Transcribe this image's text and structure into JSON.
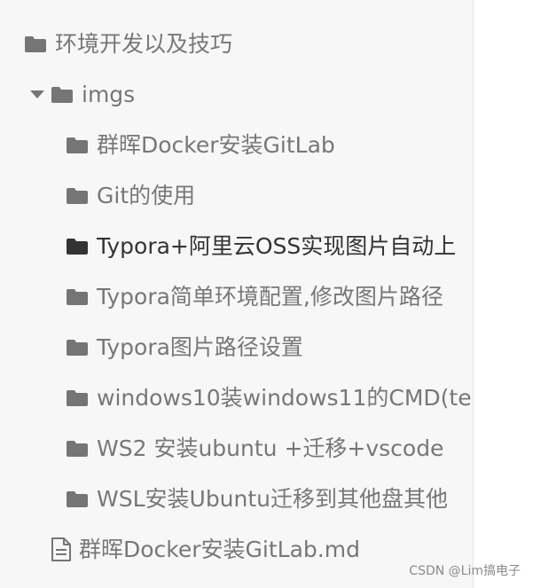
{
  "tree": {
    "root": {
      "label": "环境开发以及技巧",
      "icon": "folder-icon"
    },
    "imgs": {
      "label": "imgs",
      "icon": "folder-icon",
      "expanded": true
    },
    "children": [
      {
        "label": "群晖Docker安装GitLab",
        "icon": "folder-icon"
      },
      {
        "label": "Git的使用",
        "icon": "folder-icon"
      },
      {
        "label": "Typora+阿里云OSS实现图片自动上",
        "icon": "folder-icon",
        "active": true
      },
      {
        "label": "Typora简单环境配置,修改图片路径",
        "icon": "folder-icon"
      },
      {
        "label": "Typora图片路径设置",
        "icon": "folder-icon"
      },
      {
        "label": "windows10装windows11的CMD(te",
        "icon": "folder-icon"
      },
      {
        "label": "WS2 安装ubuntu +迁移+vscode",
        "icon": "folder-icon"
      },
      {
        "label": "WSL安装Ubuntu迁移到其他盘其他",
        "icon": "folder-icon"
      }
    ],
    "file": {
      "label": "群晖Docker安装GitLab.md",
      "icon": "file-text-icon"
    }
  },
  "watermark": "CSDN @Lim搞电子",
  "colors": {
    "sidebar_bg": "#f7f7f7",
    "folder": "#757575",
    "folder_active": "#333333",
    "text": "#777777",
    "text_active": "#333333"
  }
}
